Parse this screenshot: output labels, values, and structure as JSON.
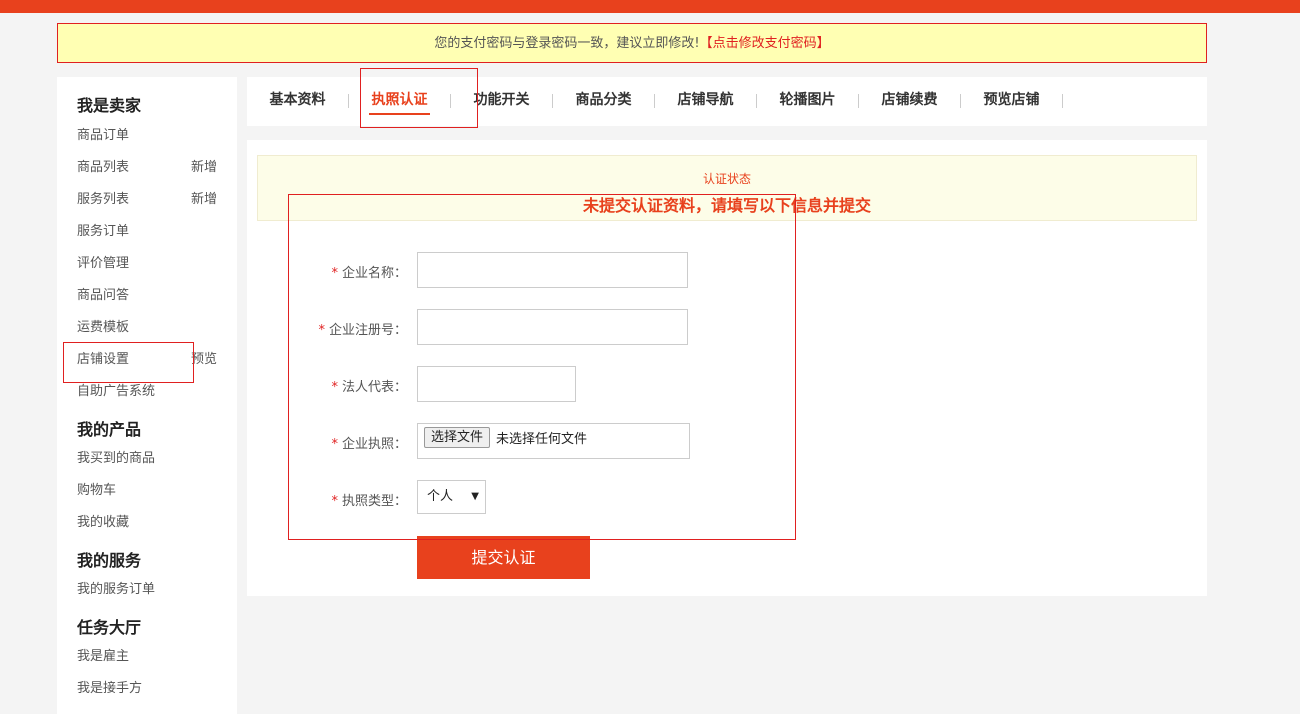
{
  "notice": {
    "text": "您的支付密码与登录密码一致，建议立即修改!",
    "bracket_open": "【",
    "link": "点击修改支付密码",
    "bracket_close": "】"
  },
  "sidebar": {
    "groups": [
      {
        "title": "我是卖家",
        "items": [
          {
            "label": "商品订单",
            "extra": ""
          },
          {
            "label": "商品列表",
            "extra": "新增"
          },
          {
            "label": "服务列表",
            "extra": "新增"
          },
          {
            "label": "服务订单",
            "extra": ""
          },
          {
            "label": "评价管理",
            "extra": ""
          },
          {
            "label": "商品问答",
            "extra": ""
          },
          {
            "label": "运费模板",
            "extra": ""
          },
          {
            "label": "店铺设置",
            "extra": "预览"
          },
          {
            "label": "自助广告系统",
            "extra": ""
          }
        ]
      },
      {
        "title": "我的产品",
        "items": [
          {
            "label": "我买到的商品"
          },
          {
            "label": "购物车"
          },
          {
            "label": "我的收藏"
          }
        ]
      },
      {
        "title": "我的服务",
        "items": [
          {
            "label": "我的服务订单"
          }
        ]
      },
      {
        "title": "任务大厅",
        "items": [
          {
            "label": "我是雇主"
          },
          {
            "label": "我是接手方"
          }
        ]
      }
    ]
  },
  "tabs": [
    "基本资料",
    "执照认证",
    "功能开关",
    "商品分类",
    "店铺导航",
    "轮播图片",
    "店铺续费",
    "预览店铺"
  ],
  "active_tab": "执照认证",
  "status": {
    "label": "认证状态",
    "message": "未提交认证资料，请填写以下信息并提交"
  },
  "form": {
    "required_mark": "*",
    "company_name_label": "企业名称：",
    "company_name_value": "",
    "reg_no_label": "企业注册号：",
    "reg_no_value": "",
    "legal_rep_label": "法人代表：",
    "legal_rep_value": "",
    "license_label": "企业执照：",
    "file_button": "选择文件",
    "file_status": "未选择任何文件",
    "license_type_label": "执照类型：",
    "license_type_value": "个人",
    "submit": "提交认证"
  },
  "colors": {
    "brand": "#e8411d",
    "notice_bg": "#ffffb3",
    "annotation": "#e02020"
  }
}
